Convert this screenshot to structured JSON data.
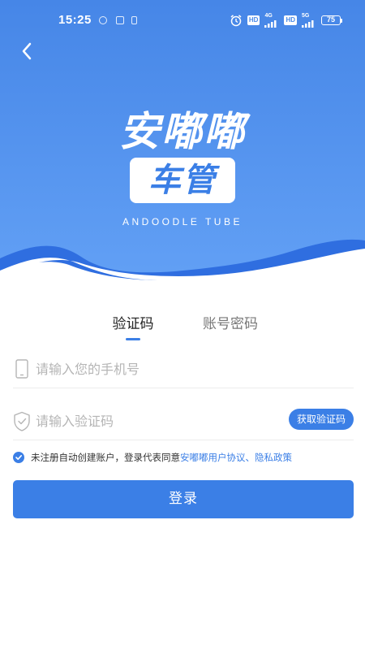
{
  "status_bar": {
    "time": "15:25",
    "hd_badge_1": "HD",
    "net_1": "4G",
    "hd_badge_2": "HD",
    "net_2": "5G",
    "battery": "75"
  },
  "header": {
    "back_icon": "chevron-left-icon",
    "logo_line1": "安嘟嘟",
    "logo_line2": "车管",
    "logo_subtitle": "ANDOODLE TUBE"
  },
  "tabs": [
    {
      "label": "验证码",
      "active": true
    },
    {
      "label": "账号密码",
      "active": false
    }
  ],
  "phone_field": {
    "icon": "phone-icon",
    "placeholder": "请输入您的手机号",
    "value": ""
  },
  "code_field": {
    "icon": "shield-check-icon",
    "placeholder": "请输入验证码",
    "value": "",
    "button_label": "获取验证码"
  },
  "agreement": {
    "checked": true,
    "prefix": "未注册自动创建账户，登录代表同意",
    "link1": "安嘟嘟用户协议",
    "separator": "、",
    "link2": "隐私政策"
  },
  "login_button": "登录",
  "colors": {
    "accent": "#3b7fe6",
    "header_gradient_top": "#4a8ae8",
    "header_gradient_bottom": "#5c9af2",
    "wave_dark": "#2f6ee0"
  }
}
